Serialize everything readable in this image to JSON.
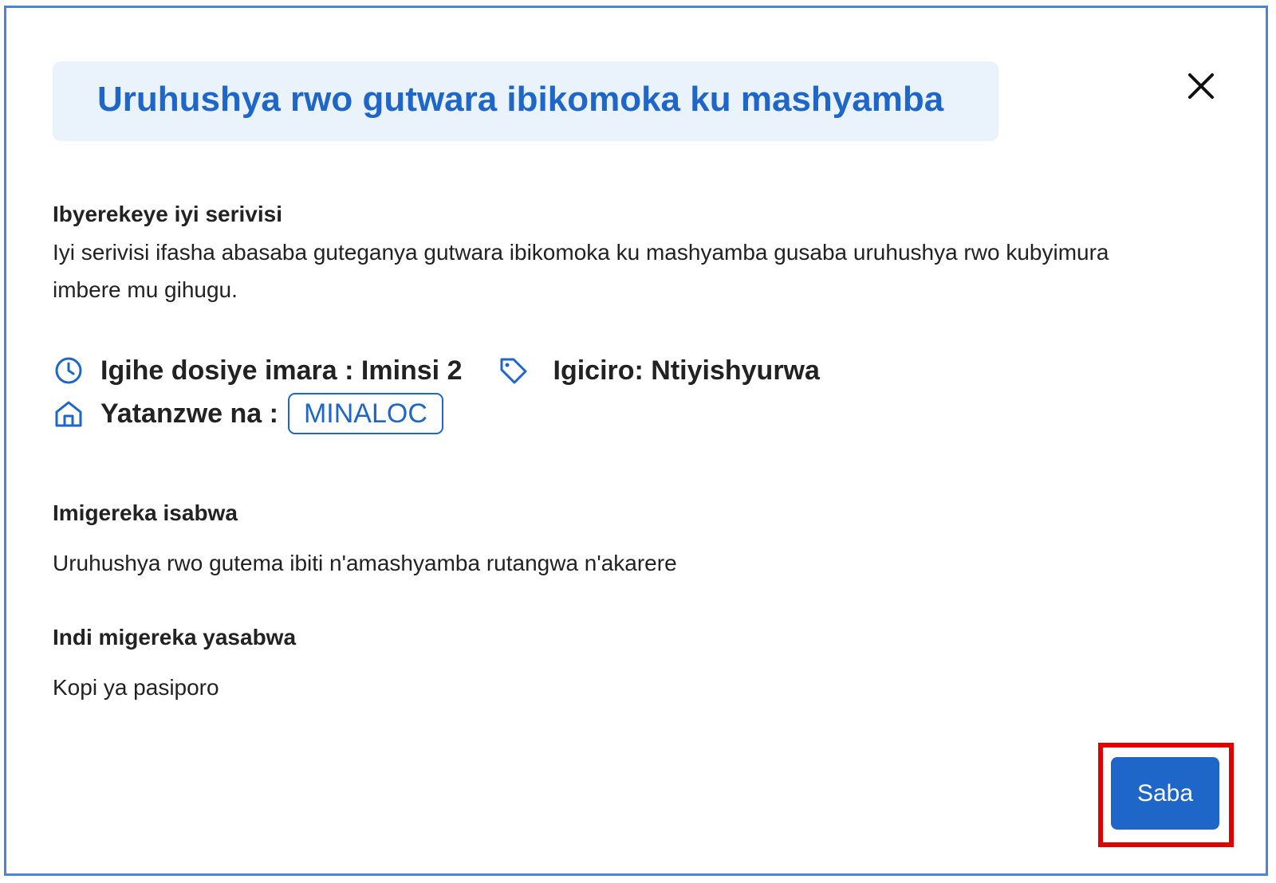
{
  "dialog": {
    "title": "Uruhushya rwo gutwara ibikomoka ku mashyamba",
    "close_icon": "close-icon",
    "accent_color": "#1f66c9",
    "title_background": "#eaf2fb"
  },
  "about": {
    "heading": "Ibyerekeye iyi serivisi",
    "description": "Iyi serivisi ifasha abasaba guteganya gutwara ibikomoka ku mashyamba gusaba uruhushya rwo kubyimura imbere mu gihugu."
  },
  "meta": {
    "duration_icon": "clock-icon",
    "duration": "Igihe dosiye imara : Iminsi 2",
    "price_icon": "tag-icon",
    "price": "Igiciro: Ntiyishyurwa",
    "provider_icon": "home-icon",
    "provider_label": "Yatanzwe na :",
    "provider": "MINALOC"
  },
  "requirements": {
    "heading": "Imigereka isabwa",
    "item": "Uruhushya rwo gutema ibiti n'amashyamba rutangwa n'akarere"
  },
  "other_requirements": {
    "heading": "Indi migereka yasabwa",
    "item": "Kopi ya pasiporo"
  },
  "actions": {
    "submit_label": "Saba",
    "highlight_color": "#e00000"
  }
}
